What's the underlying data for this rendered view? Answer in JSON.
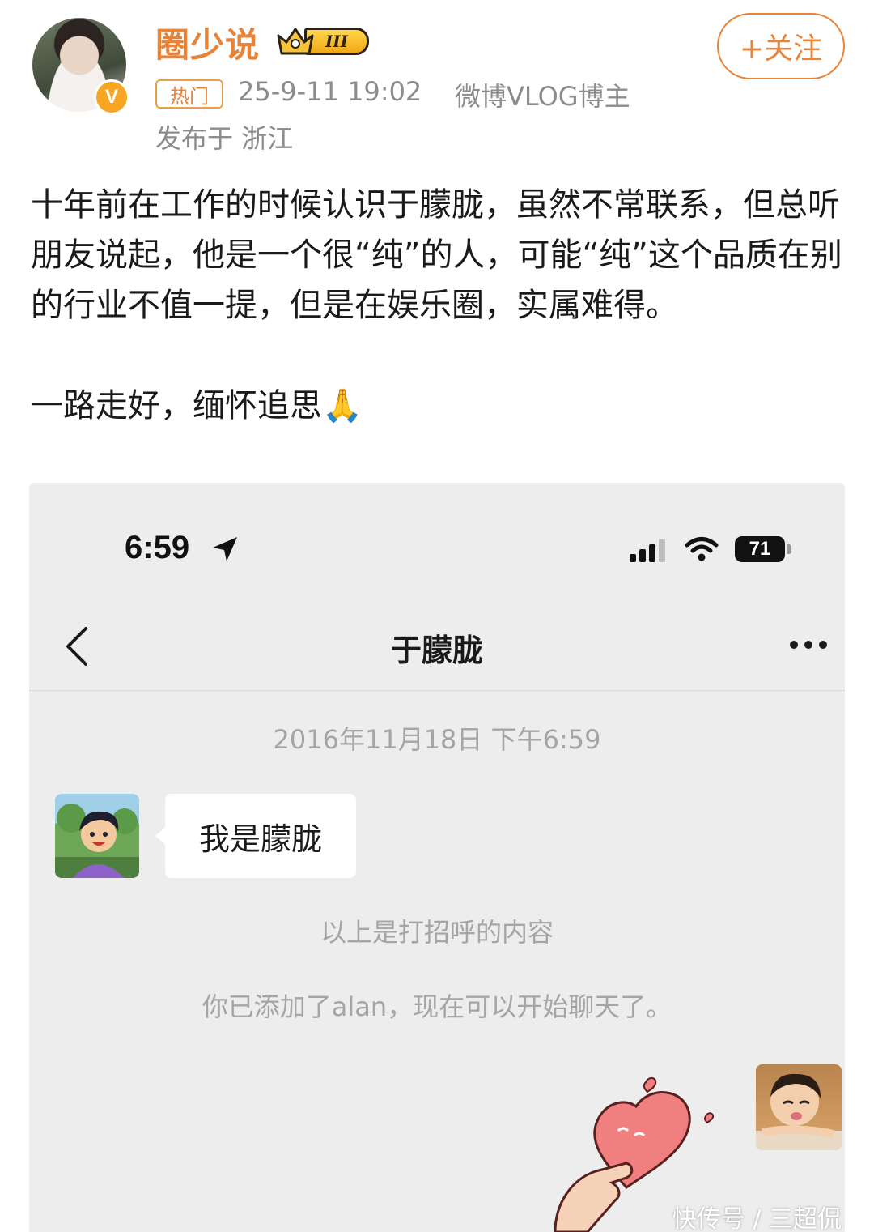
{
  "post": {
    "author": {
      "name": "圈少说",
      "level_badge": "III"
    },
    "hot_tag": "热门",
    "time": "25-9-11 19:02",
    "source": "微博VLOG博主",
    "location": "发布于 浙江",
    "follow_label": "+关注",
    "paragraphs": [
      "十年前在工作的时候认识于朦胧，虽然不常联系，但总听朋友说起，他是一个很“纯”的人，可能“纯”这个品质在别的行业不值一提，但是在娱乐圈，实属难得。",
      "一路走好，缅怀追思"
    ],
    "emoji": "🙏"
  },
  "screenshot": {
    "status_time": "6:59",
    "battery": "71",
    "chat_title": "于朦胧",
    "chat_date": "2016年11月18日 下午6:59",
    "message": "我是朦胧",
    "system_messages": [
      "以上是打招呼的内容",
      "你已添加了alan，现在可以开始聊天了。"
    ]
  },
  "watermark": "快传号 / 三超侃",
  "colors": {
    "accent": "#e8843a",
    "meta_gray": "#8c8c8c",
    "chat_bg": "#ededed",
    "system_text": "#a5a5a5"
  },
  "icons": [
    "v-verified-icon",
    "crown-icon",
    "location-arrow-icon",
    "signal-icon",
    "wifi-icon",
    "battery-icon",
    "back-icon",
    "more-icon",
    "heart-sticker"
  ]
}
